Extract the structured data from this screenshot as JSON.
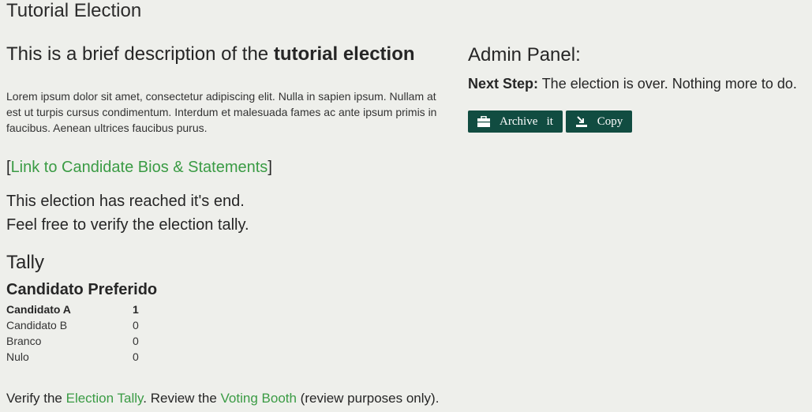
{
  "page": {
    "title": "Tutorial Election"
  },
  "description": {
    "prefix": "This is a brief description of the ",
    "bold": "tutorial election",
    "lorem": "Lorem ipsum dolor sit amet, consectetur adipiscing elit. Nulla in sapien ipsum. Nullam at est ut turpis cursus condimentum. Interdum et malesuada fames ac ante ipsum primis in faucibus. Aenean ultrices faucibus purus."
  },
  "bios": {
    "open": "[",
    "link": "Link to Candidate Bios & Statements",
    "close": "]"
  },
  "status": {
    "line1": "This election has reached it's end.",
    "line2": "Feel free to verify the election tally."
  },
  "tally": {
    "title": "Tally",
    "question": "Candidato Preferido",
    "rows": [
      {
        "name": "Candidato A",
        "votes": "1"
      },
      {
        "name": "Candidato B",
        "votes": "0"
      },
      {
        "name": "Branco",
        "votes": "0"
      },
      {
        "name": "Nulo",
        "votes": "0"
      }
    ]
  },
  "footer": {
    "verify_prefix": "Verify the ",
    "tally_link": "Election Tally",
    "middle": ". Review the ",
    "booth_link": "Voting Booth",
    "suffix": " (review purposes only)."
  },
  "admin": {
    "title": "Admin Panel:",
    "next_label": "Next Step:",
    "next_text": " The election is over. Nothing more to do.",
    "archive_label": "Archive   it",
    "copy_label": "Copy",
    "archive_icon": "briefcase-icon",
    "copy_icon": "copy-icon"
  },
  "colors": {
    "background": "#eeefeb",
    "link": "#3a9b44",
    "button": "#114c41"
  }
}
